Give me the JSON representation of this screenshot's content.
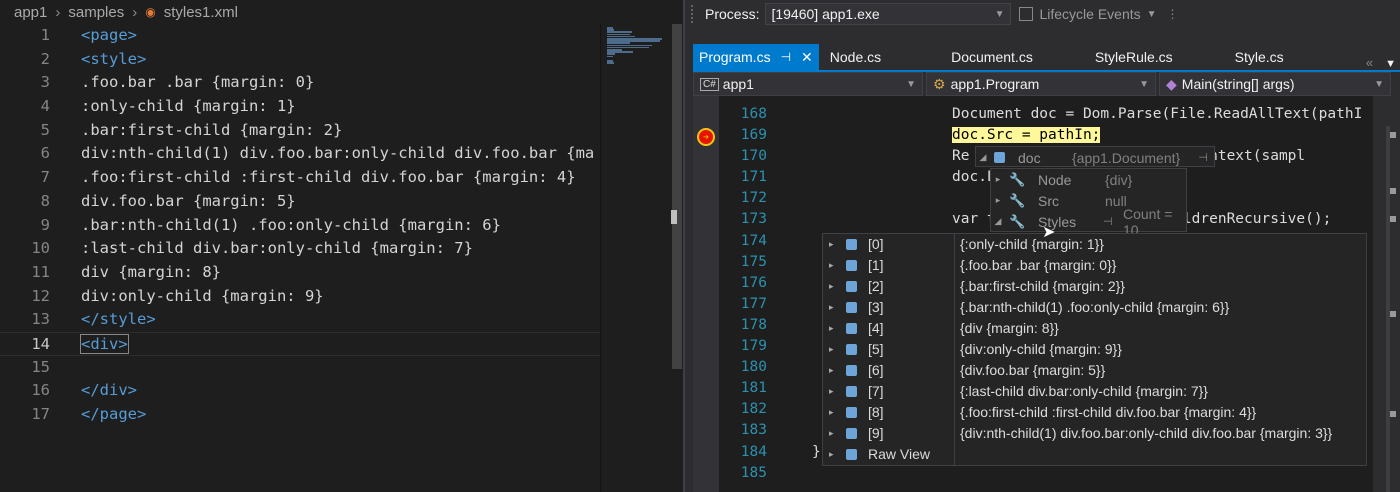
{
  "vscode": {
    "breadcrumb": [
      "app1",
      "samples",
      "styles1.xml"
    ],
    "lines": [
      {
        "num": "1",
        "text": "<page>",
        "kind": "tag"
      },
      {
        "num": "2",
        "text": "<style>",
        "kind": "tag"
      },
      {
        "num": "3",
        "text": ".foo.bar .bar {margin: 0}",
        "kind": "text"
      },
      {
        "num": "4",
        "text": ":only-child {margin: 1}",
        "kind": "text"
      },
      {
        "num": "5",
        "text": ".bar:first-child {margin: 2}",
        "kind": "text"
      },
      {
        "num": "6",
        "text": "div:nth-child(1) div.foo.bar:only-child div.foo.bar {ma",
        "kind": "text"
      },
      {
        "num": "7",
        "text": ".foo:first-child :first-child div.foo.bar {margin: 4}",
        "kind": "text"
      },
      {
        "num": "8",
        "text": "div.foo.bar {margin: 5}",
        "kind": "text"
      },
      {
        "num": "9",
        "text": ".bar:nth-child(1) .foo:only-child {margin: 6}",
        "kind": "text"
      },
      {
        "num": "10",
        "text": ":last-child div.bar:only-child {margin: 7}",
        "kind": "text"
      },
      {
        "num": "11",
        "text": "div {margin: 8}",
        "kind": "text"
      },
      {
        "num": "12",
        "text": "div:only-child {margin: 9}",
        "kind": "text"
      },
      {
        "num": "13",
        "text": "</style>",
        "kind": "tag"
      },
      {
        "num": "14",
        "text": "<div>",
        "kind": "current"
      },
      {
        "num": "15",
        "text": "",
        "kind": "text"
      },
      {
        "num": "16",
        "text": "</div>",
        "kind": "tag"
      },
      {
        "num": "17",
        "text": "</page>",
        "kind": "tag"
      }
    ]
  },
  "vs": {
    "process_label": "Process:",
    "process_value": "[19460] app1.exe",
    "lifecycle_label": "Lifecycle Events",
    "tabs": [
      {
        "label": "Program.cs",
        "active": true
      },
      {
        "label": "Node.cs",
        "active": false
      },
      {
        "label": "Document.cs",
        "active": false
      },
      {
        "label": "StyleRule.cs",
        "active": false
      },
      {
        "label": "Style.cs",
        "active": false
      }
    ],
    "nav": {
      "project": "app1",
      "type": "app1.Program",
      "member": "Main(string[] args)"
    },
    "code_lines": [
      {
        "num": "168",
        "pre": "Document doc = Dom.Parse(File.ReadAllText(pathI"
      },
      {
        "num": "169",
        "pre": "doc.Src = pathIn;"
      },
      {
        "num": "170",
        "pre": "Re"
      },
      {
        "num": "171",
        "pre": "doc.L"
      },
      {
        "num": "172",
        "pre": ""
      },
      {
        "num": "173",
        "pre": "var t"
      },
      {
        "num": "174",
        "pre": ""
      },
      {
        "num": "175",
        "pre": ""
      },
      {
        "num": "176",
        "pre": ""
      },
      {
        "num": "177",
        "pre": ""
      },
      {
        "num": "178",
        "pre": ""
      },
      {
        "num": "179",
        "pre": ""
      },
      {
        "num": "180",
        "pre": ""
      },
      {
        "num": "181",
        "pre": ""
      },
      {
        "num": "182",
        "pre": ""
      },
      {
        "num": "183",
        "pre": ""
      },
      {
        "num": "184",
        "pre": "}"
      },
      {
        "num": "185",
        "pre": ""
      }
    ],
    "code_tails": {
      "line170": "enderContext(sampl",
      "line173": "dChildrenRecursive();"
    },
    "datatip_doc": {
      "name": "doc",
      "value": "{app1.Document}"
    },
    "datatip_members": [
      {
        "name": "Node",
        "value": "{div}"
      },
      {
        "name": "Src",
        "value": "null"
      },
      {
        "name": "Styles",
        "value": "Count = 10"
      }
    ],
    "styles_items": [
      {
        "index": "[0]",
        "value": "{:only-child {margin: 1}}"
      },
      {
        "index": "[1]",
        "value": "{.foo.bar .bar {margin: 0}}"
      },
      {
        "index": "[2]",
        "value": "{.bar:first-child {margin: 2}}"
      },
      {
        "index": "[3]",
        "value": "{.bar:nth-child(1) .foo:only-child {margin: 6}}"
      },
      {
        "index": "[4]",
        "value": "{div {margin: 8}}"
      },
      {
        "index": "[5]",
        "value": "{div:only-child {margin: 9}}"
      },
      {
        "index": "[6]",
        "value": "{div.foo.bar {margin: 5}}"
      },
      {
        "index": "[7]",
        "value": "{:last-child div.bar:only-child {margin: 7}}"
      },
      {
        "index": "[8]",
        "value": "{.foo:first-child :first-child div.foo.bar {margin: 4}}"
      },
      {
        "index": "[9]",
        "value": "{div:nth-child(1) div.foo.bar:only-child div.foo.bar {margin: 3}}"
      }
    ],
    "raw_view_label": "Raw View"
  },
  "colors": {
    "accent": "#007acc",
    "tag": "#569cd6",
    "line_number_vs": "#2b91af",
    "type": "#4ec9b0",
    "highlight": "#fef89a",
    "breakpoint": "#e51400"
  }
}
